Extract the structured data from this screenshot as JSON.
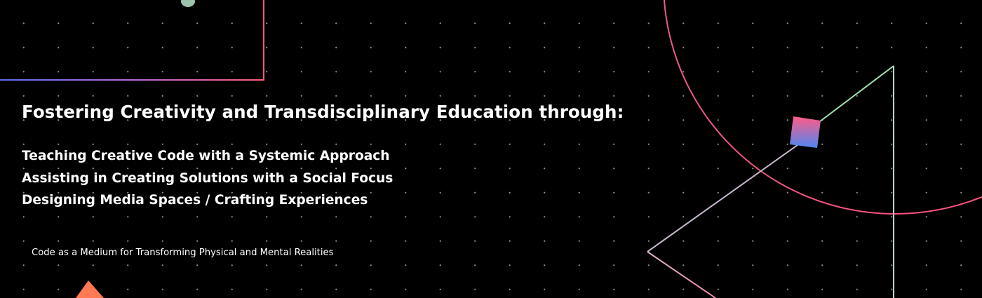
{
  "banner": {
    "headline": "Fostering Creativity and Transdisciplinary Education through:",
    "focus_items": [
      "Teaching Creative Code with a Systemic Approach",
      "Assisting in Creating Solutions with a Social Focus",
      "Designing Media Spaces / Crafting Experiences"
    ],
    "tagline": "Code as a Medium for Transforming Physical and Mental Realities"
  },
  "colors": {
    "background": "#000000",
    "text": "#ffffff",
    "accent_pink": "#f0527a",
    "accent_blue": "#5a7cf0",
    "accent_mint": "#9fe0b4",
    "accent_orange": "#ff7a52"
  }
}
